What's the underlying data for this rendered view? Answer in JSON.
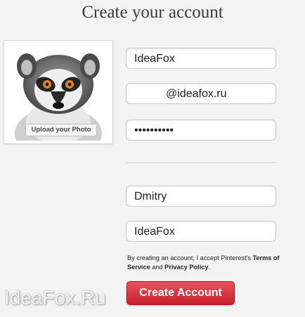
{
  "page": {
    "title": "Create your account"
  },
  "photo": {
    "upload_label": "Upload your Photo"
  },
  "form": {
    "username": "IdeaFox",
    "email_visible": "@ideafox.ru",
    "password_masked": "••••••••••",
    "first_name": "Dmitry",
    "last_name": "IdeaFox"
  },
  "terms": {
    "prefix": "By creating an account, I accept Pinterest's",
    "tos": "Terms of Service",
    "and": "and",
    "privacy": "Privacy Policy",
    "suffix": "."
  },
  "actions": {
    "create_label": "Create Account"
  },
  "watermark": "IdeaFox.Ru",
  "colors": {
    "accent": "#d1303b",
    "background": "#f4f3f3"
  }
}
